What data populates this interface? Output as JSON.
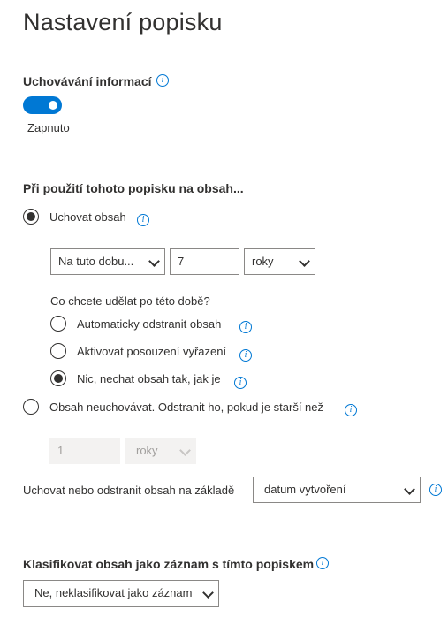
{
  "page_title": "Nastavení popisku",
  "retention": {
    "label": "Uchovávání informací",
    "toggle_state": "Zapnuto"
  },
  "apply": {
    "heading": "Při použití tohoto popisku na obsah...",
    "keep_label": "Uchovat obsah",
    "period_select": "Na tuto dobu...",
    "period_value": "7",
    "period_unit": "roky",
    "after_question": "Co chcete udělat po této době?",
    "after_options": [
      "Automaticky odstranit obsah",
      "Aktivovat posouzení vyřazení",
      "Nic, nechat obsah tak, jak je"
    ],
    "dont_keep_label": "Obsah neuchovávat. Odstranit ho, pokud je starší než",
    "dont_keep_value": "1",
    "dont_keep_unit": "roky",
    "basis_label": "Uchovat nebo odstranit obsah na základě",
    "basis_value": "datum vytvoření"
  },
  "classify": {
    "label": "Klasifikovat obsah jako záznam s tímto popiskem",
    "value": "Ne, neklasifikovat jako záznam"
  },
  "icons": {
    "info": "info-icon",
    "chevron": "chevron-down-icon"
  },
  "colors": {
    "accent": "#0078d4",
    "text": "#323130",
    "disabled_bg": "#f3f2f1"
  }
}
